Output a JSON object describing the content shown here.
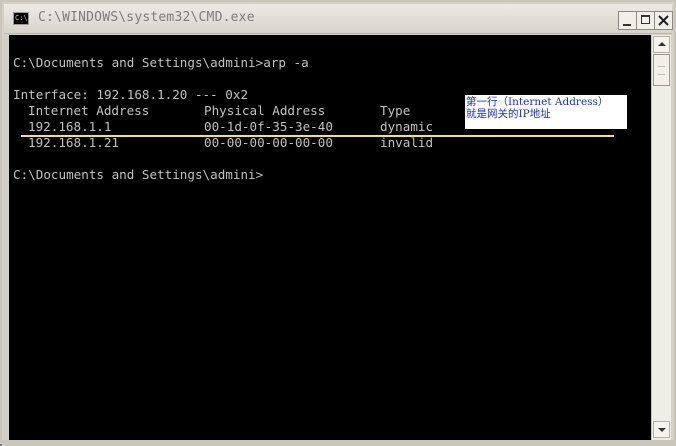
{
  "window": {
    "title": "C:\\WINDOWS\\system32\\CMD.exe",
    "app_icon_text": "C:\\"
  },
  "console": {
    "lines": [
      "C:\\Documents and Settings\\admini>arp -a",
      "Interface: 192.168.1.20 --- 0x2",
      "C:\\Documents and Settings\\admini>"
    ],
    "table": {
      "headers": [
        "Internet Address",
        "Physical Address",
        "Type"
      ],
      "rows": [
        [
          "192.168.1.1",
          "00-1d-0f-35-3e-40",
          "dynamic"
        ],
        [
          "192.168.1.21",
          "00-00-00-00-00-00",
          "invalid"
        ]
      ]
    }
  },
  "annotation": {
    "line1": "第一行（Internet Address）",
    "line2": "就是网关的IP地址"
  },
  "colors": {
    "console_bg": "#000000",
    "console_text": "#c0c0c0",
    "annotation_text": "#1a2fd0",
    "highlight_line": "#f3e07a"
  },
  "icons": {
    "app": "cmd-icon",
    "minimize": "minimize-icon",
    "maximize": "maximize-icon",
    "close": "close-icon",
    "scroll_up": "scroll-up-arrow-icon",
    "scroll_down": "scroll-down-arrow-icon"
  }
}
